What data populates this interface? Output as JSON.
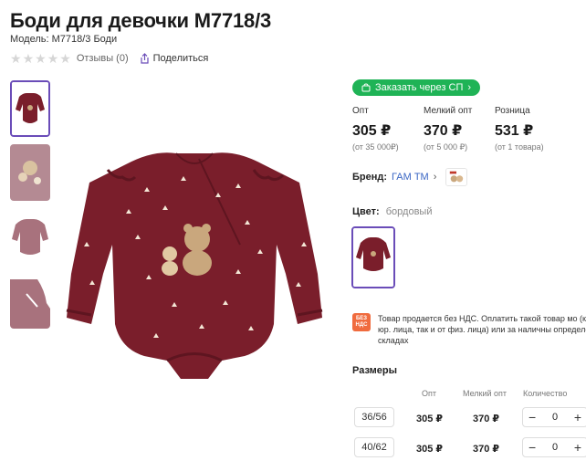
{
  "product": {
    "title": "Боди для девочки M7718/3",
    "model": "Модель: M7718/3 Боди",
    "reviews": "Отзывы (0)",
    "share": "Поделиться"
  },
  "sp_button": "Заказать через СП",
  "prices": [
    {
      "label": "Опт",
      "value": "305 ₽",
      "sub": "(от 35 000₽)"
    },
    {
      "label": "Мелкий опт",
      "value": "370 ₽",
      "sub": "(от 5 000 ₽)"
    },
    {
      "label": "Розница",
      "value": "531 ₽",
      "sub": "(от 1 товара)"
    }
  ],
  "brand": {
    "label": "Бренд:",
    "name": "ГАМ ТМ"
  },
  "color": {
    "label": "Цвет:",
    "value": "бордовый"
  },
  "vat": {
    "badge": "БЕЗ НДС",
    "text": "Товар продается без НДС. Оплатить такой товар мо (как от юр. лица, так и от физ. лица) или за наличны определённых складах"
  },
  "sizes": {
    "title": "Размеры",
    "headers": {
      "opt": "Опт",
      "small_opt": "Мелкий опт",
      "qty": "Количество"
    },
    "rows": [
      {
        "size": "36/56",
        "opt": "305 ₽",
        "small_opt": "370 ₽",
        "qty": "0"
      },
      {
        "size": "40/62",
        "opt": "305 ₽",
        "small_opt": "370 ₽",
        "qty": "0"
      }
    ]
  },
  "colors": {
    "accent": "#6a4cb8",
    "green": "#1fb356",
    "garment": "#7a1e2b",
    "link": "#3a66c4",
    "vat": "#f06b3e"
  }
}
